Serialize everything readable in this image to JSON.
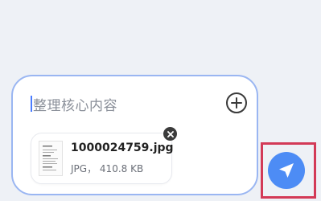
{
  "composer": {
    "placeholder": "整理核心内容"
  },
  "attachment": {
    "file_name": "1000024759.jpg",
    "file_type": "JPG",
    "separator": "，",
    "file_size": "410.8 KB"
  },
  "icons": {
    "add": "plus-circle-icon",
    "remove": "close-icon",
    "send": "paper-plane-icon"
  },
  "colors": {
    "composer_border": "#9ab6f2",
    "send_button": "#4d8cf5",
    "highlight_frame": "#d33a57"
  }
}
